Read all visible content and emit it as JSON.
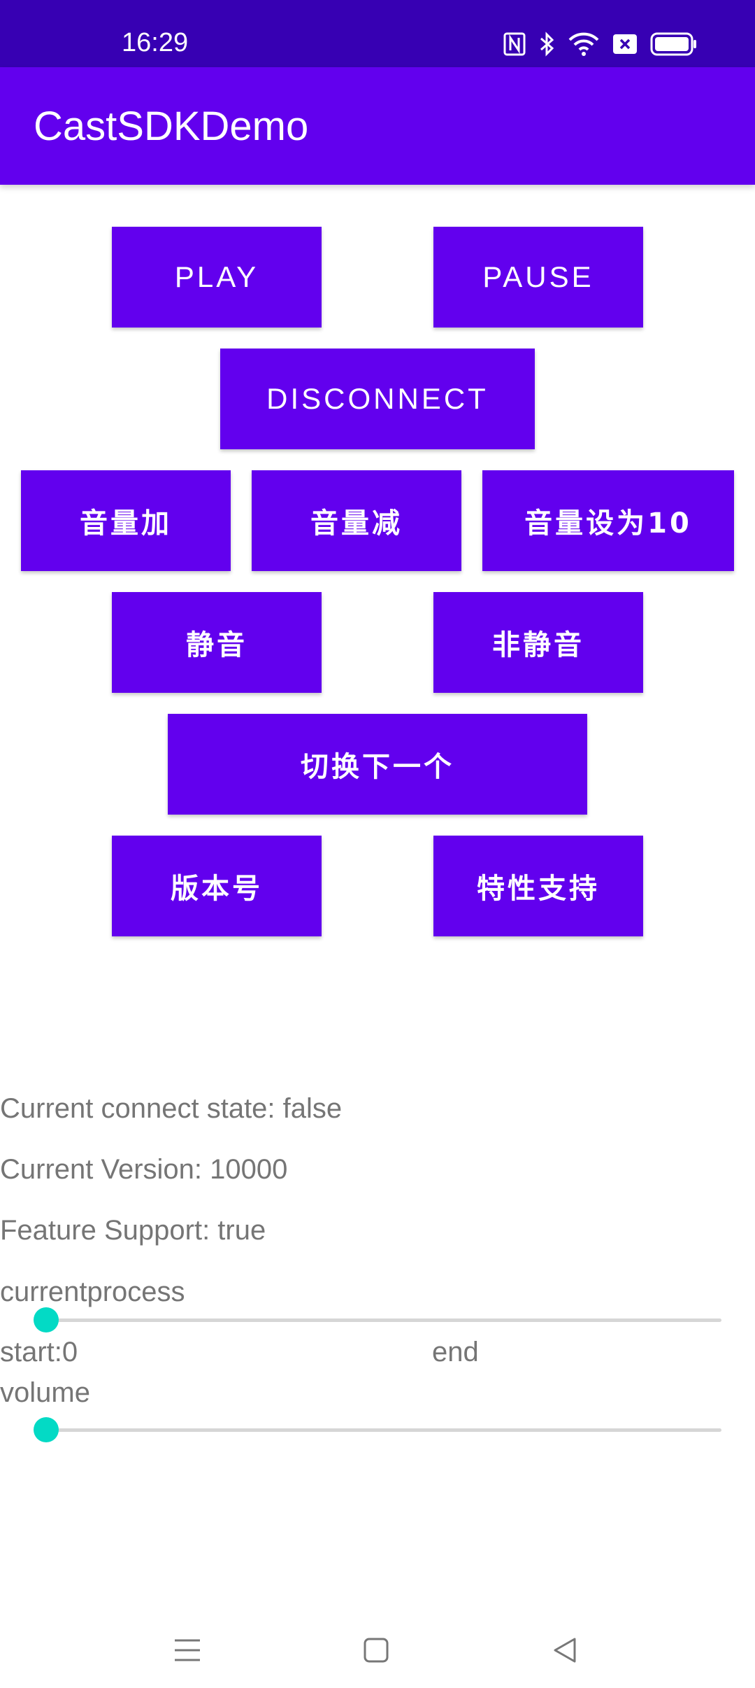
{
  "status_bar": {
    "time": "16:29",
    "icons": [
      "nfc-icon",
      "bluetooth-icon",
      "wifi-icon",
      "sim-off-icon",
      "battery-icon"
    ]
  },
  "app_bar": {
    "title": "CastSDKDemo"
  },
  "buttons": {
    "play": "PLAY",
    "pause": "PAUSE",
    "disconnect": "DISCONNECT",
    "volume_up": "音量加",
    "volume_down": "音量减",
    "volume_set10": "音量设为10",
    "mute": "静音",
    "unmute": "非静音",
    "next": "切换下一个",
    "version": "版本号",
    "feature": "特性支持"
  },
  "info": {
    "connect_state": "Current connect state: false",
    "version": "Current Version: 10000",
    "feature_support": "Feature Support: true",
    "process_label": "currentprocess",
    "start_label": "start:0",
    "end_label": "end",
    "volume_label": "volume"
  },
  "sliders": {
    "process_value": 0,
    "volume_value": 0
  },
  "colors": {
    "status_bar": "#3700B3",
    "primary": "#6200EE",
    "accent": "#03DAC5",
    "text_secondary": "#757575"
  },
  "nav_bar": {
    "icons": [
      "menu-icon",
      "home-icon",
      "back-icon"
    ]
  }
}
